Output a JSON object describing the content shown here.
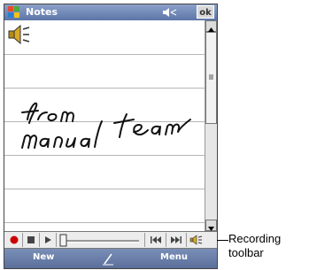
{
  "titlebar": {
    "title": "Notes",
    "ok_label": "ok"
  },
  "note": {
    "handwriting_line1": "from",
    "handwriting_line2": "manual team"
  },
  "menubar": {
    "new_label": "New",
    "menu_label": "Menu"
  },
  "callout": {
    "line1": "Recording",
    "line2": "toolbar"
  },
  "icons": [
    "windows-start-icon",
    "volume-icon",
    "speaker-icon",
    "record-icon",
    "stop-icon",
    "play-icon",
    "rewind-icon",
    "fast-forward-icon",
    "speaker-toggle-icon",
    "pen-icon"
  ],
  "colors": {
    "titlebar": "#5d76a8",
    "record": "#cc0000",
    "rule": "#b6b6b6"
  },
  "recording": {
    "volume_level": 0.0
  }
}
